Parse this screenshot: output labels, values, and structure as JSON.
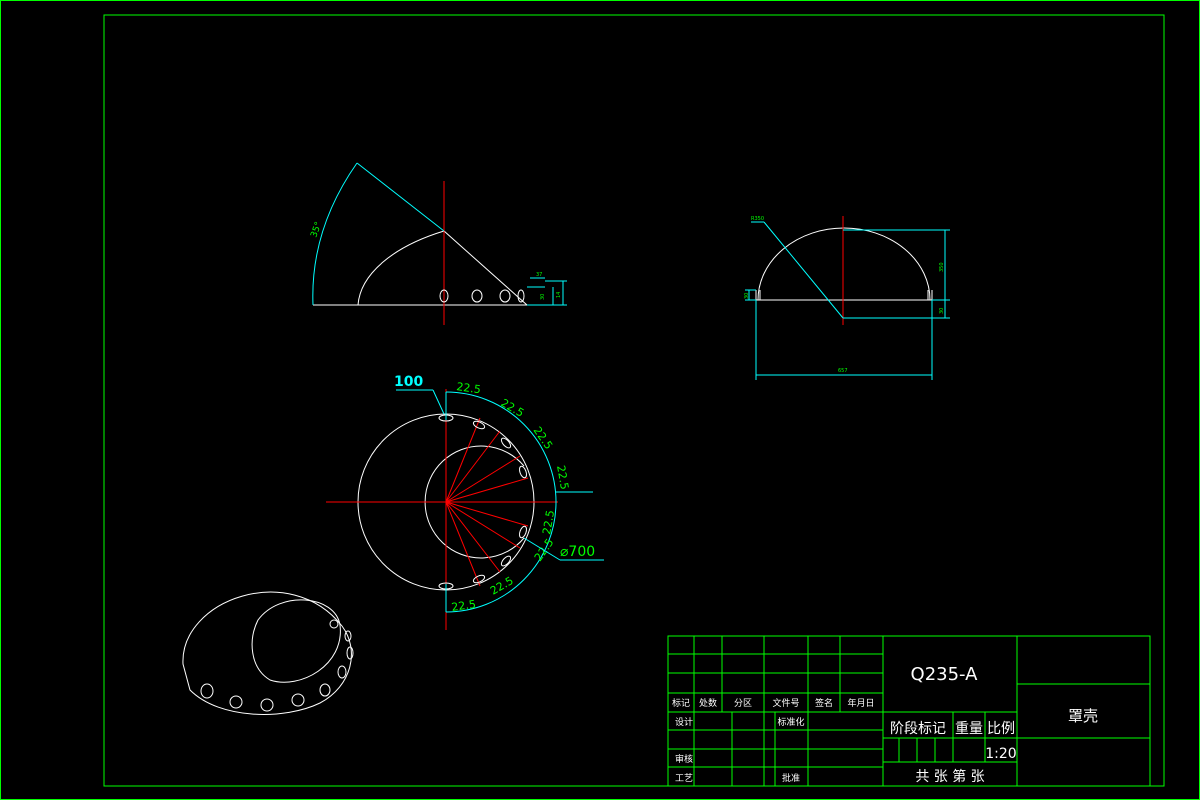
{
  "drawing": {
    "material": "Q235-A",
    "part_name": "罩壳",
    "scale": "1:20",
    "stage_mark_label": "阶段标记",
    "weight_label": "重量",
    "scale_label": "比例",
    "sheet_count_label": "共 张  第 张"
  },
  "title_block": {
    "header_row": [
      "标记",
      "处数",
      "分区",
      "文件号",
      "签名",
      "年月日"
    ],
    "design_label": "设计",
    "standardization_label": "标准化",
    "review_label": "审核",
    "process_label": "工艺",
    "approve_label": "批准"
  },
  "dimensions": {
    "angle_label": "35°",
    "hole_spacing_label": "100",
    "angle_step": "22.5",
    "diameter_label": "⌀700",
    "small_a": "37",
    "small_b": "30",
    "small_c": "14",
    "right_radius": "R350",
    "right_height": "350",
    "right_left_h": "30",
    "right_bottom_h": "30",
    "right_width": "657"
  },
  "colors": {
    "frame": "#00ff00",
    "outline": "#ffffff",
    "center_line": "#ff0000",
    "dimension": "#00ffff"
  }
}
